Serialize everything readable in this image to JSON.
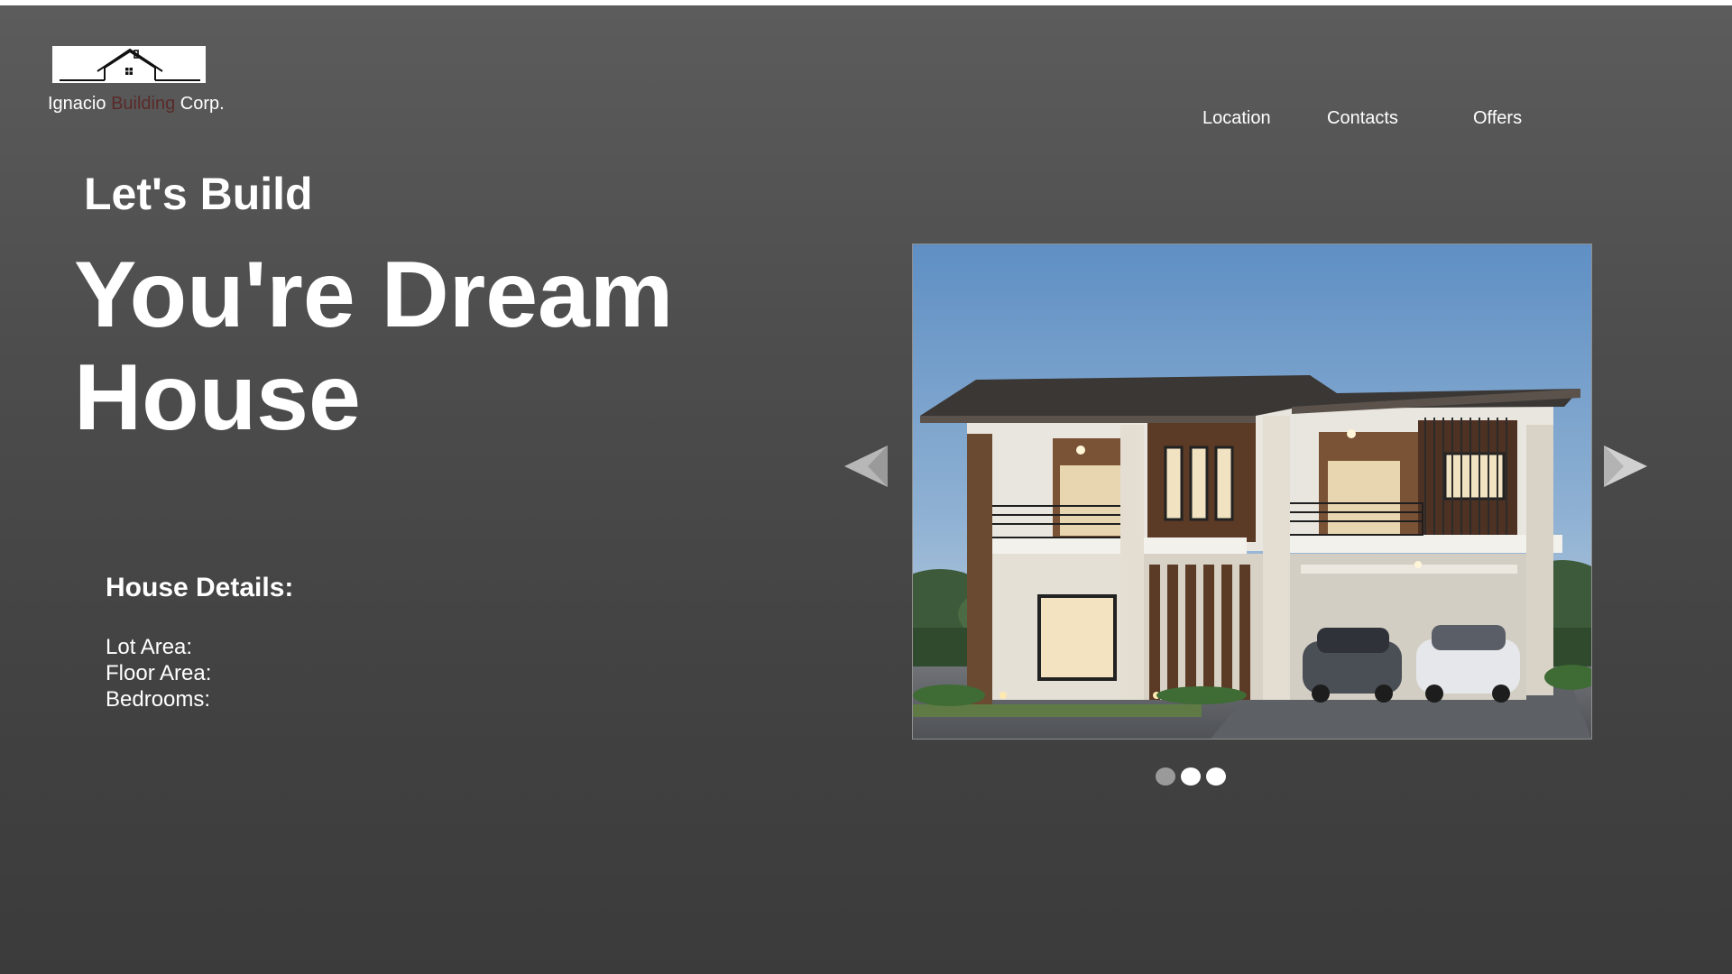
{
  "brand": {
    "name_part1": "Ignacio ",
    "name_accent": "Building",
    "name_part2": " Corp.",
    "logo_icon": "house-outline-icon"
  },
  "nav": {
    "items": [
      {
        "label": "Location"
      },
      {
        "label": "Contacts"
      },
      {
        "label": "Offers"
      }
    ]
  },
  "hero": {
    "kicker": "Let's Build",
    "line1": "You're Dream",
    "line2": "House"
  },
  "details": {
    "title": "House Details:",
    "lot_area_label": "Lot Area:",
    "floor_area_label": "Floor Area:",
    "bedrooms_label": "Bedrooms:"
  },
  "slider": {
    "prev_icon": "triangle-left-icon",
    "next_icon": "triangle-right-icon",
    "slide_count": 3,
    "active_index": 0
  },
  "colors": {
    "brand_accent": "#5a2a2a",
    "text": "#ffffff",
    "dot_active": "#9a9a9a",
    "dot_inactive": "#ffffff"
  }
}
